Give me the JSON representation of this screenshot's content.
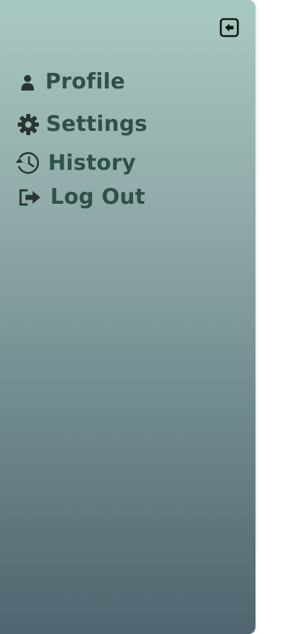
{
  "drawer": {
    "close_icon": "arrow-left-square-icon",
    "items": [
      {
        "label": "Profile",
        "icon": "user-icon"
      },
      {
        "label": "Settings",
        "icon": "gear-icon"
      },
      {
        "label": "History",
        "icon": "history-icon"
      },
      {
        "label": "Log Out",
        "icon": "logout-icon"
      }
    ]
  },
  "colors": {
    "gradient_top": "#a8c9c1",
    "gradient_bottom": "#4f6670",
    "text": "#2f5149"
  }
}
